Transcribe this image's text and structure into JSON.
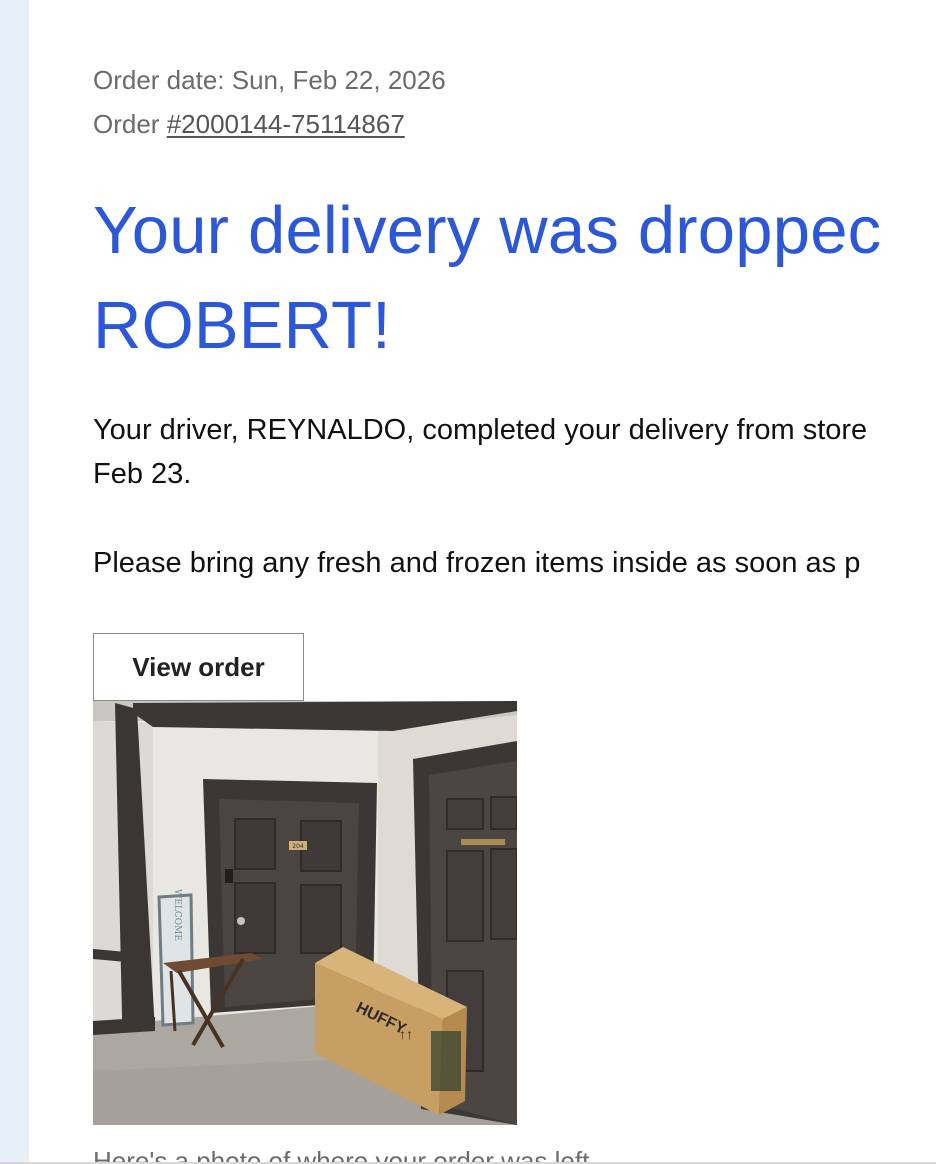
{
  "order": {
    "date_label": "Order date: Sun, Feb 22, 2026",
    "number_prefix": "Order ",
    "number_link": "#2000144-75114867"
  },
  "headline": {
    "line1": "Your delivery was droppec",
    "line2": "ROBERT!"
  },
  "body": {
    "driver_line1": "Your driver, REYNALDO, completed your delivery from store",
    "driver_line2": "Feb 23.",
    "reminder": "Please bring any fresh and frozen items inside as soon as p"
  },
  "actions": {
    "view_order_label": "View order"
  },
  "photo": {
    "alt": "Delivery photo",
    "caption": "Here's a photo of where your order was left",
    "door_plate": "204",
    "box_brand": "HUFFY",
    "sign_text": "WELCOME"
  },
  "colors": {
    "headline": "#2c58d8",
    "meta": "#6b6b6b",
    "gutter": "#e7eff9"
  }
}
